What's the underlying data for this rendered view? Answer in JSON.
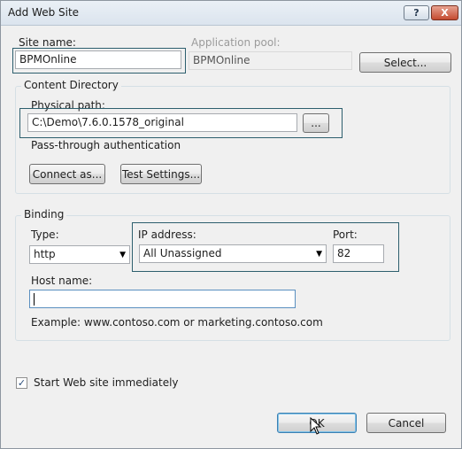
{
  "window": {
    "title": "Add Web Site",
    "help_label": "?",
    "close_label": "X"
  },
  "site": {
    "site_name_label": "Site name:",
    "site_name_value": "BPMOnline",
    "app_pool_label": "Application pool:",
    "app_pool_value": "BPMOnline",
    "select_label": "Select..."
  },
  "content_directory": {
    "group_title": "Content Directory",
    "physical_path_label": "Physical path:",
    "physical_path_value": "C:\\Demo\\7.6.0.1578_original",
    "browse_label": "...",
    "passthrough_label": "Pass-through authentication",
    "connect_as_label": "Connect as...",
    "test_settings_label": "Test Settings..."
  },
  "binding": {
    "group_title": "Binding",
    "type_label": "Type:",
    "type_value": "http",
    "ip_label": "IP address:",
    "ip_value": "All Unassigned",
    "port_label": "Port:",
    "port_value": "82",
    "host_label": "Host name:",
    "host_value": "",
    "example_text": "Example: www.contoso.com or marketing.contoso.com"
  },
  "start_immediately": {
    "label": "Start Web site immediately",
    "checked": true,
    "check_glyph": "✓"
  },
  "footer": {
    "ok_label": "OK",
    "cancel_label": "Cancel"
  }
}
